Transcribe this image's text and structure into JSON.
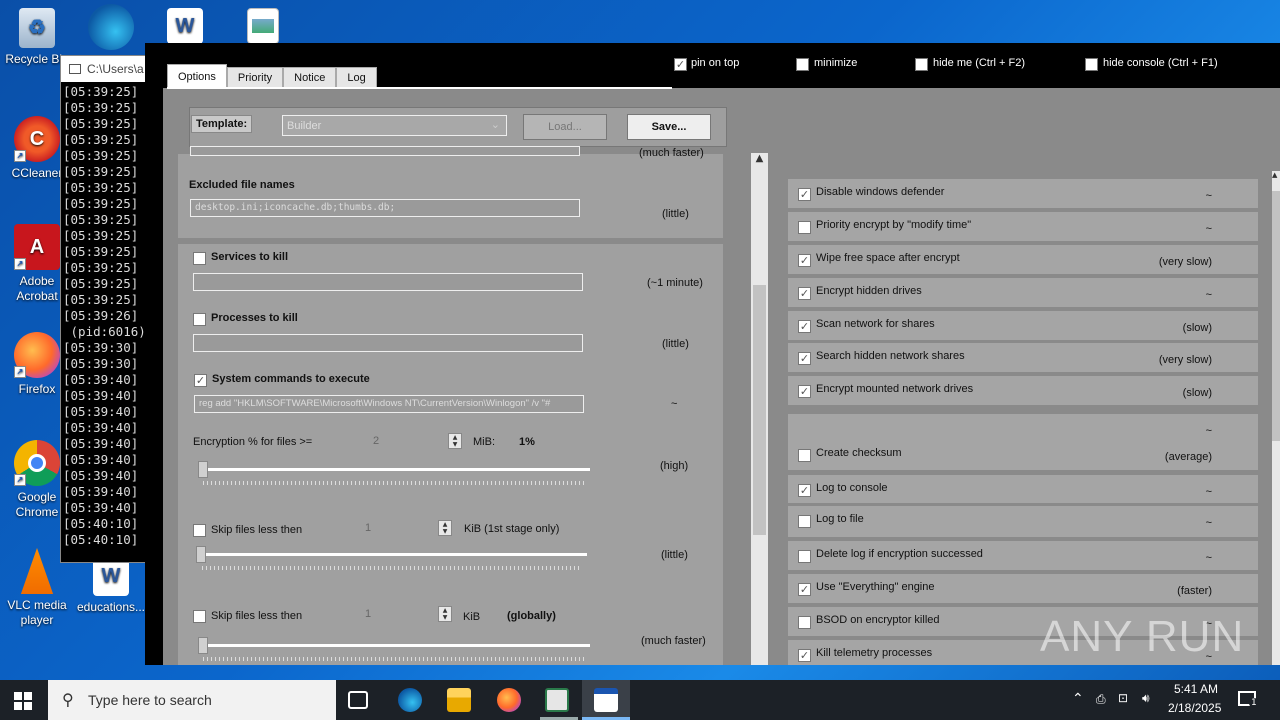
{
  "desktop": {
    "icons": [
      {
        "label": "Recycle Bin",
        "icon": "recycle-bin-icon"
      },
      {
        "label": "CCleaner",
        "icon": "ccleaner-icon"
      },
      {
        "label": "Adobe Acrobat",
        "icon": "adobe-acrobat-icon"
      },
      {
        "label": "Firefox",
        "icon": "firefox-icon"
      },
      {
        "label": "Google Chrome",
        "icon": "chrome-icon"
      },
      {
        "label": "VLC media player",
        "icon": "vlc-icon"
      },
      {
        "label": "educations...",
        "icon": "word-doc-icon"
      },
      {
        "label": "",
        "icon": "edge-icon"
      },
      {
        "label": "",
        "icon": "word-doc-icon"
      },
      {
        "label": "",
        "icon": "image-file-icon"
      }
    ]
  },
  "console": {
    "title": "C:\\Users\\a",
    "lines": [
      "[05:39:25]",
      "[05:39:25]",
      "[05:39:25]",
      "[05:39:25]",
      "[05:39:25]",
      "[05:39:25]",
      "[05:39:25]",
      "[05:39:25]",
      "[05:39:25]",
      "[05:39:25]",
      "[05:39:25]",
      "[05:39:25]",
      "[05:39:25]",
      "[05:39:25]",
      "[05:39:26]",
      " (pid:6016)",
      "[05:39:30]",
      "[05:39:30]",
      "[05:39:40]",
      "[05:39:40]",
      "[05:39:40]",
      "[05:39:40]",
      "[05:39:40]",
      "[05:39:40]",
      "[05:39:40]",
      "[05:39:40]",
      "[05:39:40]",
      "[05:40:10]",
      "[05:40:10]"
    ]
  },
  "app": {
    "tabs": [
      "Options",
      "Priority",
      "Notice",
      "Log"
    ],
    "top_options": [
      {
        "label": "pin on top",
        "checked": true
      },
      {
        "label": "minimize",
        "checked": false
      },
      {
        "label": "hide me (Ctrl + F2)",
        "checked": false
      },
      {
        "label": "hide console (Ctrl + F1)",
        "checked": false
      }
    ],
    "template": {
      "label": "Template:",
      "value": "Builder",
      "load_label": "Load...",
      "save_label": "Save..."
    },
    "left": {
      "cut_top_note": "(much faster)",
      "excluded_label": "Excluded file names",
      "excluded_value": "desktop.ini;iconcache.db;thumbs.db;",
      "excluded_note": "(little)",
      "services_label": "Services to kill",
      "services_note": "(~1 minute)",
      "processes_label": "Processes to kill",
      "processes_note": "(little)",
      "syscmd_label": "System commands to execute",
      "syscmd_value": "reg add \"HKLM\\SOFTWARE\\Microsoft\\Windows NT\\CurrentVersion\\Winlogon\" /v \"#",
      "syscmd_note": "~",
      "enc_label": "Encryption % for files >=",
      "enc_value": "2",
      "enc_unit": "MiB:",
      "enc_percent": "1%",
      "enc_note": "(high)",
      "skip1_label": "Skip files less then",
      "skip1_value": "1",
      "skip1_unit": "KiB (1st stage only)",
      "skip1_note": "(little)",
      "skip2_label": "Skip files less then",
      "skip2_value": "1",
      "skip2_unit": "KiB",
      "skip2_unit_bold": "(globally)",
      "skip2_note": "(much faster)"
    },
    "right": [
      {
        "name": "Disable windows defender",
        "value": "~",
        "checked": true
      },
      {
        "name": "Priority encrypt by \"modify time\"",
        "value": "~",
        "checked": false
      },
      {
        "name": "Wipe free space after encrypt",
        "value": "(very slow)",
        "checked": true
      },
      {
        "name": "Encrypt hidden drives",
        "value": "~",
        "checked": true
      },
      {
        "name": "Scan network for shares",
        "value": "(slow)",
        "checked": true
      },
      {
        "name": "Search hidden network shares",
        "value": "(very slow)",
        "checked": true
      },
      {
        "name": "Encrypt mounted network drives",
        "value": "(slow)",
        "checked": true
      },
      {
        "name": "",
        "value": "~",
        "checked": null
      },
      {
        "name": "Create checksum",
        "value": "(average)",
        "checked": false
      },
      {
        "name": "Log to console",
        "value": "~",
        "checked": true
      },
      {
        "name": "Log to file",
        "value": "~",
        "checked": false
      },
      {
        "name": "Delete log if encryption successed",
        "value": "~",
        "checked": false
      },
      {
        "name": "Use \"Everything\" engine",
        "value": "(faster)",
        "checked": true
      },
      {
        "name": "BSOD on encryptor killed",
        "value": "~",
        "checked": false
      },
      {
        "name": "Kill telemetry processes",
        "value": "~",
        "checked": true
      }
    ]
  },
  "taskbar": {
    "search_placeholder": "Type here to search",
    "date": "2/18/2025",
    "time": "5:41 AM",
    "notification_count": "1"
  },
  "watermark": "ANY RUN"
}
